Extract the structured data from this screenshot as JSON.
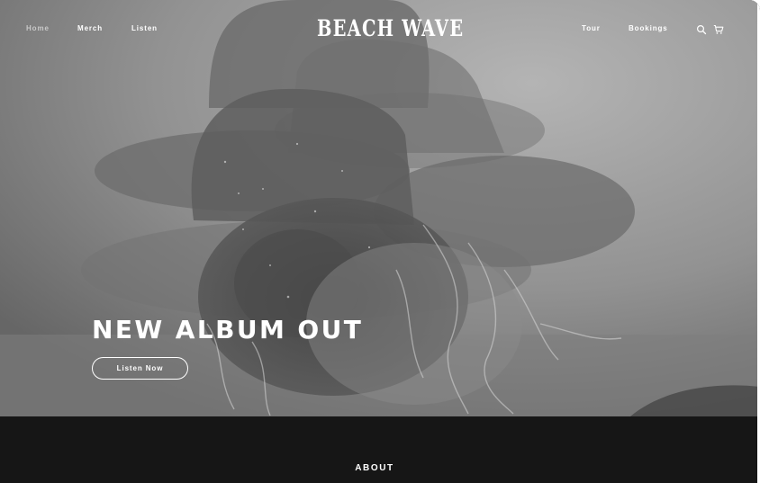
{
  "nav": {
    "left_items": [
      {
        "label": "Home",
        "active": true
      },
      {
        "label": "Merch",
        "active": false
      },
      {
        "label": "Listen",
        "active": false
      }
    ],
    "right_items": [
      {
        "label": "Tour"
      },
      {
        "label": "Bookings"
      }
    ],
    "icons": [
      "search-icon",
      "cart-icon"
    ]
  },
  "brand": {
    "logo_text": "BEACH WAVE"
  },
  "hero": {
    "headline": "NEW ALBUM OUT",
    "cta_label": "Listen Now"
  },
  "about": {
    "heading": "ABOUT"
  },
  "colors": {
    "text": "#ffffff",
    "nav_active": "#c9c9c9",
    "footer_bg": "#161616"
  }
}
